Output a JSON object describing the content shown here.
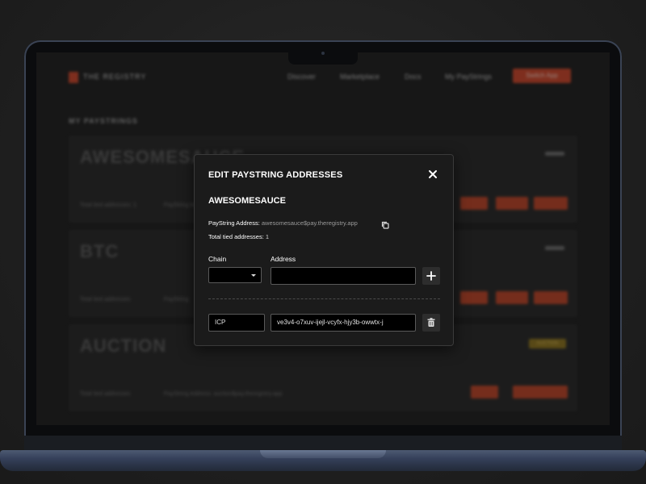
{
  "background_app": {
    "brand": "THE REGISTRY",
    "nav_links": [
      "Discover",
      "Marketplace",
      "Docs",
      "My PayStrings"
    ],
    "nav_button": "Switch App",
    "section_title": "MY PAYSTRINGS",
    "cards": [
      {
        "name": "AWESOMESAUCE",
        "meta": "Total tied addresses: 1",
        "meta2": "PayString Address"
      },
      {
        "name": "BTC",
        "meta": "Total tied addresses",
        "meta2": "PayString"
      },
      {
        "name": "AUCTION",
        "meta": "Total tied addresses",
        "meta2": "PayString Address: auction$pay.theregistry.app",
        "badge": "AUCTION"
      }
    ]
  },
  "modal": {
    "title": "EDIT PAYSTRING ADDRESSES",
    "paystring_name": "AWESOMESAUCE",
    "paystring_address_label": "PayString Address:",
    "paystring_address_value": "awesomesauce$pay.theregistry.app",
    "total_label": "Total tied addresses:",
    "total_value": "1",
    "chain_label": "Chain",
    "address_label": "Address",
    "new_chain_value": "",
    "new_address_value": "",
    "entries": [
      {
        "chain": "ICP",
        "address": "ve3v4-o7xuv-ijejl-vcyfx-hjy3b-owwtx-j"
      }
    ]
  },
  "colors": {
    "accent": "#c9472c",
    "modal_bg": "#1b1b1b",
    "laptop_frame": "#3a4354"
  }
}
